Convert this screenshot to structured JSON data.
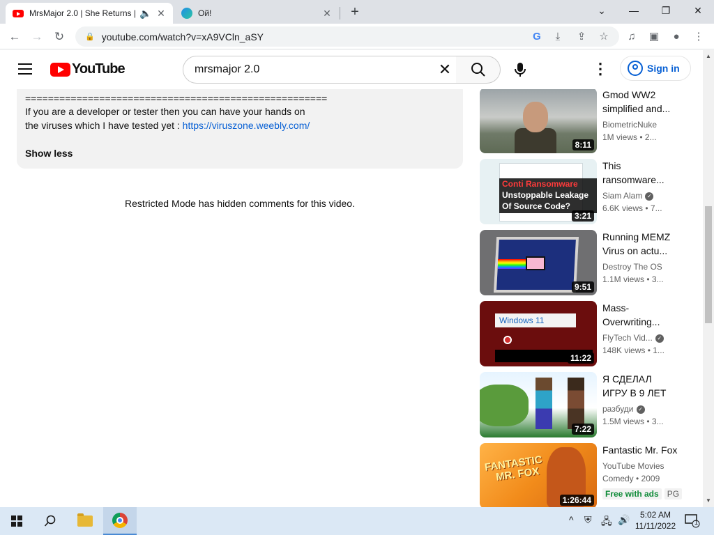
{
  "browser": {
    "tabs": [
      {
        "title": "MrsMajor 2.0 | She Returns |",
        "active": true
      },
      {
        "title": "Ой!",
        "active": false
      }
    ],
    "url": "youtube.com/watch?v=xA9VCln_aSY"
  },
  "youtube": {
    "logo_text": "YouTube",
    "search_query": "mrsmajor 2.0",
    "sign_in_label": "Sign in"
  },
  "description": {
    "separator": "=====================================================",
    "line1": "If you are a developer or tester then you can have your hands on",
    "line2_prefix": "the viruses which I have tested yet : ",
    "link": "https://viruszone.weebly.com/",
    "show_less": "Show less"
  },
  "comments_notice": "Restricted Mode has hidden comments for this video.",
  "recommendations": [
    {
      "title": "Gmod WW2 simplified and...",
      "channel": "BiometricNuke",
      "verified": false,
      "meta": "1M views • 2...",
      "duration": "8:11"
    },
    {
      "title": "This ransomware...",
      "channel": "Siam Alam",
      "verified": true,
      "meta": "6.6K views • 7...",
      "duration": "3:21",
      "thumb_text": [
        "Conti Ransomware",
        "Unstoppable Leakage",
        "Of Source Code?"
      ]
    },
    {
      "title": "Running MEMZ Virus on actu...",
      "channel": "Destroy The OS",
      "verified": false,
      "meta": "1.1M views • 3...",
      "duration": "9:51"
    },
    {
      "title": "Mass-Overwriting...",
      "channel": "FlyTech Vid...",
      "verified": true,
      "meta": "148K views • 1...",
      "duration": "11:22",
      "thumb_text": [
        "Windows 11"
      ]
    },
    {
      "title": "Я СДЕЛАЛ ИГРУ В 9 ЛЕТ",
      "channel": "разбуди",
      "verified": true,
      "meta": "1.5M views • 3...",
      "duration": "7:22"
    },
    {
      "title": "Fantastic Mr. Fox",
      "channel": "YouTube Movies",
      "verified": false,
      "meta": "Comedy • 2009",
      "duration": "1:26:44",
      "badges": [
        "Free with ads",
        "PG"
      ],
      "thumb_text": [
        "FANTASTIC",
        "MR. FOX"
      ]
    }
  ],
  "taskbar": {
    "time": "5:02 AM",
    "date": "11/11/2022",
    "notification_count": "1"
  },
  "colors": {
    "youtube_red": "#ff0000",
    "link_blue": "#065fd4",
    "taskbar": "#dbe8f5"
  }
}
